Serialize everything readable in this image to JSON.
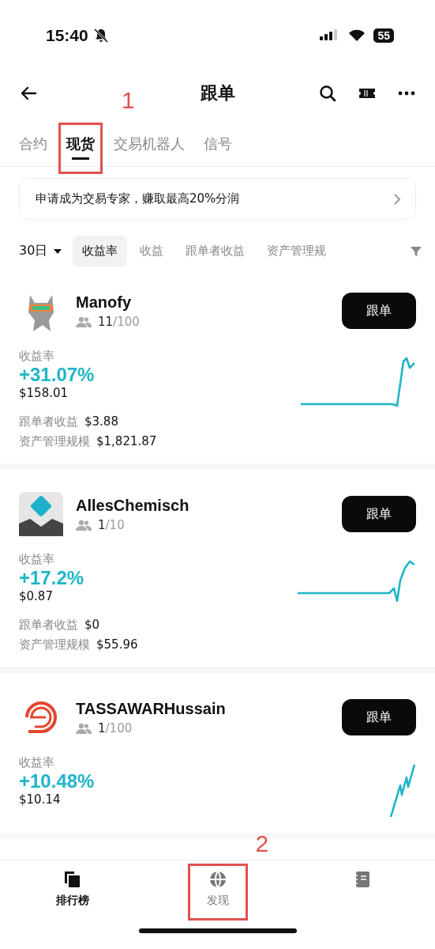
{
  "status_bar": {
    "time": "15:40",
    "battery": "55"
  },
  "header": {
    "title": "跟单"
  },
  "tabs": [
    {
      "label": "合约",
      "selected": false
    },
    {
      "label": "现货",
      "selected": true,
      "annotation": "1"
    },
    {
      "label": "交易机器人",
      "selected": false
    },
    {
      "label": "信号",
      "selected": false
    }
  ],
  "banner": {
    "text": "申请成为交易专家，赚取最高20%分润"
  },
  "filters": {
    "period": "30日",
    "sorts": [
      {
        "label": "收益率",
        "selected": true
      },
      {
        "label": "收益",
        "selected": false
      },
      {
        "label": "跟单者收益",
        "selected": false
      },
      {
        "label": "资产管理规",
        "selected": false
      }
    ]
  },
  "traders": [
    {
      "name": "Manofy",
      "followers": "11",
      "capacity": "/100",
      "rate_label": "收益率",
      "rate": "+31.07%",
      "profit": "$158.01",
      "button": "跟单",
      "stats": [
        {
          "label": "跟单者收益",
          "value": "$3.88"
        },
        {
          "label": "资产管理规模",
          "value": "$1,821.87"
        }
      ]
    },
    {
      "name": "AllesChemisch",
      "followers": "1",
      "capacity": "/10",
      "rate_label": "收益率",
      "rate": "+17.2%",
      "profit": "$0.87",
      "button": "跟单",
      "stats": [
        {
          "label": "跟单者收益",
          "value": "$0"
        },
        {
          "label": "资产管理规模",
          "value": "$55.96"
        }
      ]
    },
    {
      "name": "TASSAWARHussain",
      "followers": "1",
      "capacity": "/100",
      "rate_label": "收益率",
      "rate": "+10.48%",
      "profit": "$10.14",
      "button": "跟单"
    }
  ],
  "bottom_nav": [
    {
      "label": "排行榜",
      "selected": true
    },
    {
      "label": "发现",
      "selected": false,
      "annotation": "2"
    },
    {
      "selected": false
    }
  ]
}
